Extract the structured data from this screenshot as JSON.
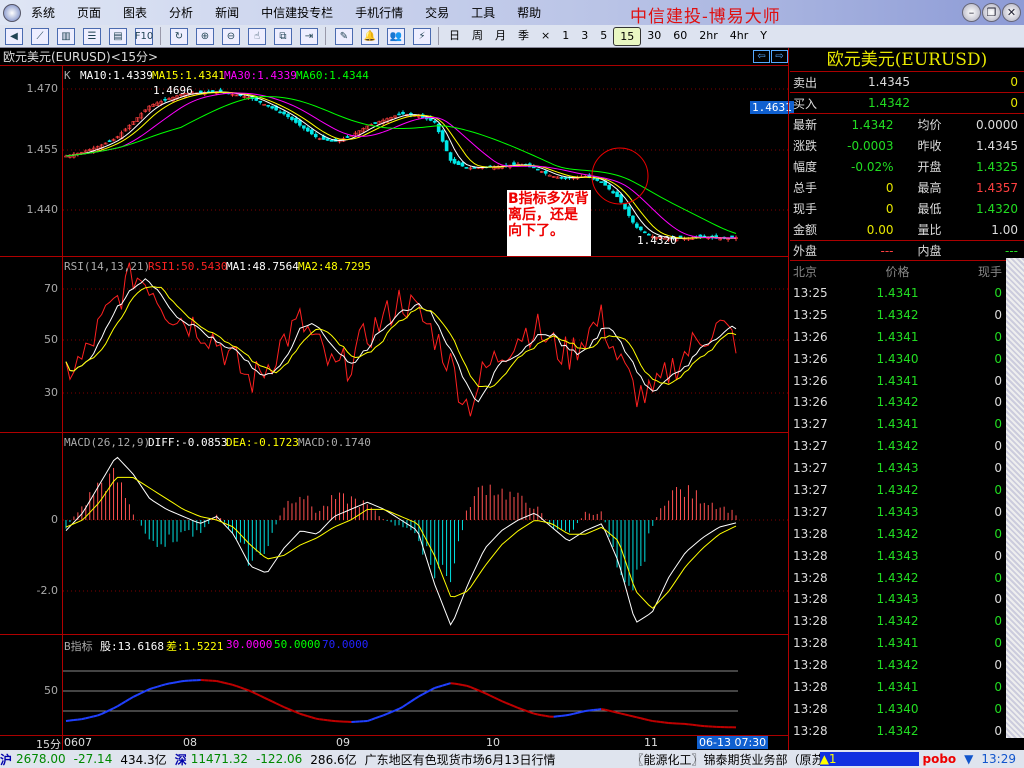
{
  "menu": {
    "items": [
      "系统",
      "页面",
      "图表",
      "分析",
      "新闻",
      "中信建投专栏",
      "手机行情",
      "交易",
      "工具",
      "帮助"
    ],
    "brand": "中信建投-博易大师"
  },
  "window": {
    "min": "–",
    "restore": "❐",
    "close": "✕"
  },
  "toolbar": {
    "icons": [
      "back-icon",
      "line-chart-icon",
      "kline-icon",
      "list-icon",
      "report-icon",
      "f10-icon",
      "refresh-icon",
      "zoom-in-icon",
      "zoom-out-icon",
      "select-icon",
      "window-icon",
      "export-icon",
      "draw-icon",
      "alarm-icon",
      "users-icon",
      "flash-icon"
    ],
    "f10": "F10",
    "periods": [
      "日",
      "周",
      "月",
      "季",
      "×",
      "1",
      "3",
      "5",
      "15",
      "30",
      "60",
      "2hr",
      "4hr",
      "Y"
    ],
    "selected_period": "15"
  },
  "chart": {
    "title": "欧元美元(EURUSD)<15分>",
    "prev": "⇦",
    "next": "⇨",
    "price_legend": {
      "k": "K",
      "ma10": "MA10:1.4339",
      "ma15": "MA15:1.4341",
      "ma30": "MA30:1.4339",
      "ma60": "MA60:1.4344"
    },
    "price_ticks": [
      "1.470",
      "1.455",
      "1.440"
    ],
    "high_label": "1.4696",
    "low_label": "1.4320",
    "current_price": "1.4631",
    "annotation": "B指标多次背离后，还是向下了。",
    "rsi_legend": {
      "name": "RSI(14,13,21)",
      "rsi1": "RSI1:50.5430",
      "ma1": "MA1:48.7564",
      "ma2": "MA2:48.7295"
    },
    "rsi_ticks": [
      "70",
      "50",
      "30"
    ],
    "macd_legend": {
      "name": "MACD(26,12,9)",
      "diff": "DIFF:-0.0853",
      "dea": "DEA:-0.1723",
      "macd": "MACD:0.1740"
    },
    "macd_ticks": [
      "0",
      "-2.0"
    ],
    "b_legend": {
      "name": "B指标",
      "gu": "股:13.6168",
      "cha": "差:1.5221",
      "l30": "30.0000",
      "l50": "50.0000",
      "l70": "70.0000"
    },
    "b_ticks": [
      "50"
    ],
    "period_label": "15分",
    "time_labels": [
      "0607",
      "08",
      "09",
      "10",
      "11"
    ],
    "cursor_time": "06-13 07:30"
  },
  "chart_data": {
    "type": "candlestick",
    "bars": 170,
    "close": [
      1.4535,
      1.4545,
      1.456,
      1.458,
      1.462,
      1.466,
      1.4675,
      1.469,
      1.4692,
      1.4695,
      1.4688,
      1.468,
      1.466,
      1.464,
      1.461,
      1.458,
      1.457,
      1.4585,
      1.461,
      1.4625,
      1.464,
      1.4635,
      1.462,
      1.452,
      1.4505,
      1.4508,
      1.451,
      1.4515,
      1.4505,
      1.4485,
      1.448,
      1.4485,
      1.447,
      1.443,
      1.436,
      1.4335,
      1.433,
      1.4332,
      1.4335,
      1.433,
      1.4333
    ],
    "rsi": [
      38,
      42,
      55,
      65,
      75,
      72,
      62,
      58,
      55,
      50,
      42,
      34,
      40,
      50,
      57,
      48,
      38,
      42,
      52,
      58,
      66,
      60,
      52,
      40,
      24,
      38,
      45,
      52,
      55,
      48,
      44,
      52,
      58,
      42,
      30,
      28,
      38,
      45,
      52,
      55,
      50
    ],
    "rsi_ylim": [
      20,
      80
    ],
    "macd_diff": [
      -0.3,
      0.2,
      1.0,
      1.8,
      1.3,
      0.6,
      0.3,
      0.1,
      -0.1,
      0.1,
      -0.4,
      -1.3,
      -1.5,
      -0.8,
      -0.3,
      -0.4,
      0.1,
      0.3,
      0.5,
      0.3,
      0.0,
      -0.3,
      -1.8,
      -3.0,
      -1.8,
      -0.8,
      -0.3,
      0.0,
      0.2,
      -0.2,
      -0.6,
      -0.3,
      -0.1,
      -1.2,
      -2.9,
      -2.6,
      -1.6,
      -0.9,
      -0.5,
      -0.2,
      -0.08
    ],
    "macd_dea": [
      -0.2,
      0.0,
      0.5,
      1.2,
      1.2,
      0.9,
      0.6,
      0.3,
      0.1,
      0.0,
      -0.2,
      -0.7,
      -1.1,
      -1.0,
      -0.7,
      -0.5,
      -0.2,
      0.0,
      0.3,
      0.3,
      0.1,
      -0.1,
      -1.0,
      -2.2,
      -2.0,
      -1.3,
      -0.7,
      -0.3,
      0.0,
      -0.1,
      -0.4,
      -0.4,
      -0.2,
      -0.6,
      -2.0,
      -2.5,
      -2.0,
      -1.3,
      -0.8,
      -0.4,
      -0.17
    ],
    "macd_ylim": [
      -3.2,
      2.0
    ],
    "b_gu": [
      20,
      22,
      26,
      34,
      44,
      52,
      57,
      60,
      61,
      60,
      56,
      50,
      42,
      34,
      27,
      22,
      20,
      19,
      20,
      26,
      33,
      44,
      53,
      58,
      55,
      48,
      40,
      33,
      27,
      24,
      26,
      30,
      32,
      28,
      24,
      20,
      18,
      17,
      15,
      14,
      13.6
    ],
    "b_ylim": [
      5,
      75
    ],
    "b_levels": [
      30,
      50,
      70
    ]
  },
  "quote": {
    "title": "欧元美元(EURUSD)",
    "sell_label": "卖出",
    "sell": "1.4345",
    "sell_vol": "0",
    "buy_label": "买入",
    "buy": "1.4342",
    "buy_vol": "0",
    "stats": [
      [
        "最新",
        "1.4342",
        "均价",
        "0.0000"
      ],
      [
        "涨跌",
        "-0.0003",
        "昨收",
        "1.4345"
      ],
      [
        "幅度",
        "-0.02%",
        "开盘",
        "1.4325"
      ],
      [
        "总手",
        "0",
        "最高",
        "1.4357"
      ],
      [
        "现手",
        "0",
        "最低",
        "1.4320"
      ],
      [
        "金额",
        "0.00",
        "量比",
        "1.00"
      ]
    ],
    "outer_label": "外盘",
    "outer": "---",
    "inner_label": "内盘",
    "inner": "---"
  },
  "ticks": {
    "headers": [
      "北京",
      "价格",
      "现手"
    ],
    "rows": [
      [
        "13:25",
        "1.4341",
        "0",
        "g"
      ],
      [
        "13:25",
        "1.4342",
        "0",
        "w"
      ],
      [
        "13:26",
        "1.4341",
        "0",
        "g"
      ],
      [
        "13:26",
        "1.4340",
        "0",
        "g"
      ],
      [
        "13:26",
        "1.4341",
        "0",
        "w"
      ],
      [
        "13:26",
        "1.4342",
        "0",
        "w"
      ],
      [
        "13:27",
        "1.4341",
        "0",
        "g"
      ],
      [
        "13:27",
        "1.4342",
        "0",
        "w"
      ],
      [
        "13:27",
        "1.4343",
        "0",
        "w"
      ],
      [
        "13:27",
        "1.4342",
        "0",
        "g"
      ],
      [
        "13:27",
        "1.4343",
        "0",
        "w"
      ],
      [
        "13:28",
        "1.4342",
        "0",
        "g"
      ],
      [
        "13:28",
        "1.4343",
        "0",
        "w"
      ],
      [
        "13:28",
        "1.4342",
        "0",
        "g"
      ],
      [
        "13:28",
        "1.4343",
        "0",
        "w"
      ],
      [
        "13:28",
        "1.4342",
        "0",
        "g"
      ],
      [
        "13:28",
        "1.4341",
        "0",
        "g"
      ],
      [
        "13:28",
        "1.4342",
        "0",
        "w"
      ],
      [
        "13:28",
        "1.4341",
        "0",
        "g"
      ],
      [
        "13:28",
        "1.4340",
        "0",
        "g"
      ],
      [
        "13:28",
        "1.4342",
        "0",
        "w"
      ]
    ]
  },
  "status": {
    "sh_label": "沪",
    "sh": "2678.00",
    "sh_chg": "-27.14",
    "sh_amt": "434.3亿",
    "sz_label": "深",
    "sz": "11471.32",
    "sz_chg": "-122.06",
    "sz_amt": "286.6亿",
    "news1": "广东地区有色现货市场6月13日行情",
    "news2": "〖能源化工〗锦泰期货业务部（原苏物期货",
    "alert": "▲1",
    "pobo": "pobo",
    "time": "13:29"
  }
}
